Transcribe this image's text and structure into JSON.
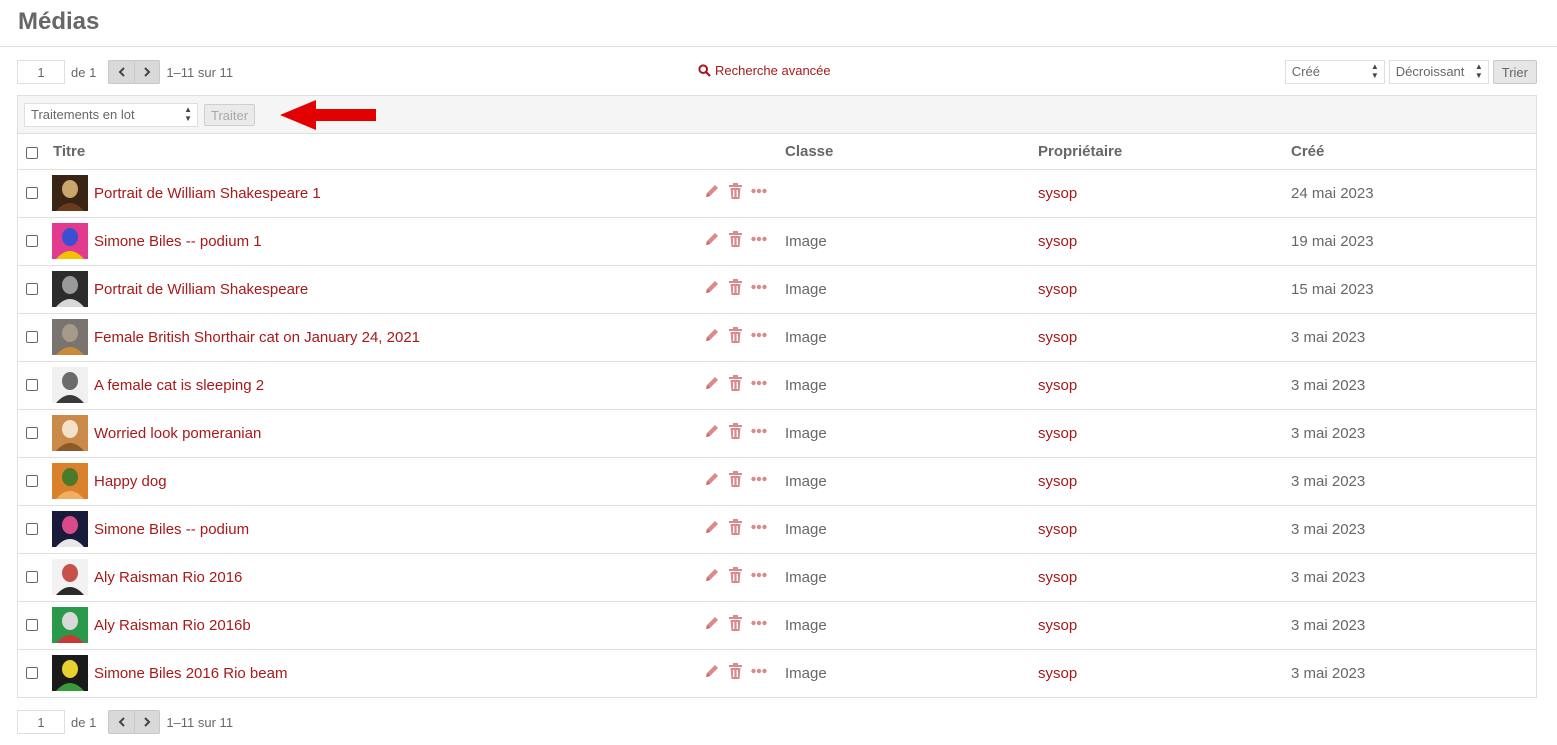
{
  "page_title": "Médias",
  "pagination": {
    "page": "1",
    "of_label": "de 1",
    "range": "1–11 sur 11"
  },
  "advanced_search": "Recherche avancée",
  "sort": {
    "by": "Créé",
    "order": "Décroissant",
    "button": "Trier"
  },
  "batch": {
    "select": "Traitements en lot",
    "apply": "Traiter"
  },
  "columns": {
    "title": "Titre",
    "class": "Classe",
    "owner": "Propriétaire",
    "created": "Créé"
  },
  "items": [
    {
      "title": "Portrait de William Shakespeare 1",
      "class": "",
      "owner": "sysop",
      "created": "24 mai 2023",
      "thumb": [
        "#3a2414",
        "#c9a66b",
        "#6b3b1e"
      ]
    },
    {
      "title": "Simone Biles -- podium 1",
      "class": "Image",
      "owner": "sysop",
      "created": "19 mai 2023",
      "thumb": [
        "#e23a8f",
        "#3a4fd1",
        "#f2c200"
      ]
    },
    {
      "title": "Portrait de William Shakespeare",
      "class": "Image",
      "owner": "sysop",
      "created": "15 mai 2023",
      "thumb": [
        "#2c2c2c",
        "#9a9a9a",
        "#d8d8d8"
      ]
    },
    {
      "title": "Female British Shorthair cat on January 24, 2021",
      "class": "Image",
      "owner": "sysop",
      "created": "3 mai 2023",
      "thumb": [
        "#7a7470",
        "#a89a8a",
        "#c98a3a"
      ]
    },
    {
      "title": "A female cat is sleeping 2",
      "class": "Image",
      "owner": "sysop",
      "created": "3 mai 2023",
      "thumb": [
        "#f0f0f0",
        "#6b6b6b",
        "#3a3a3a"
      ]
    },
    {
      "title": "Worried look pomeranian",
      "class": "Image",
      "owner": "sysop",
      "created": "3 mai 2023",
      "thumb": [
        "#c98a4a",
        "#f3e2c8",
        "#8a5a2a"
      ]
    },
    {
      "title": "Happy dog",
      "class": "Image",
      "owner": "sysop",
      "created": "3 mai 2023",
      "thumb": [
        "#d9822b",
        "#4a7a2a",
        "#f0b060"
      ]
    },
    {
      "title": "Simone Biles -- podium",
      "class": "Image",
      "owner": "sysop",
      "created": "3 mai 2023",
      "thumb": [
        "#1a1a3a",
        "#d94a8a",
        "#e8e8e8"
      ]
    },
    {
      "title": "Aly Raisman Rio 2016",
      "class": "Image",
      "owner": "sysop",
      "created": "3 mai 2023",
      "thumb": [
        "#f2f2f2",
        "#c8504a",
        "#2a2a2a"
      ]
    },
    {
      "title": "Aly Raisman Rio 2016b",
      "class": "Image",
      "owner": "sysop",
      "created": "3 mai 2023",
      "thumb": [
        "#2a9a4a",
        "#d9d9d9",
        "#c83a3a"
      ]
    },
    {
      "title": "Simone Biles 2016 Rio beam",
      "class": "Image",
      "owner": "sysop",
      "created": "3 mai 2023",
      "thumb": [
        "#1a1a1a",
        "#e8d030",
        "#3a9a3a"
      ]
    }
  ],
  "colors": {
    "accent": "#a91919",
    "icon": "#d98a8a",
    "annotation_arrow": "#e30000"
  },
  "icons": {
    "edit": "pencil-icon",
    "delete": "trash-icon",
    "more": "ellipsis-icon",
    "search": "search-icon",
    "prev": "chevron-left-icon",
    "next": "chevron-right-icon"
  }
}
